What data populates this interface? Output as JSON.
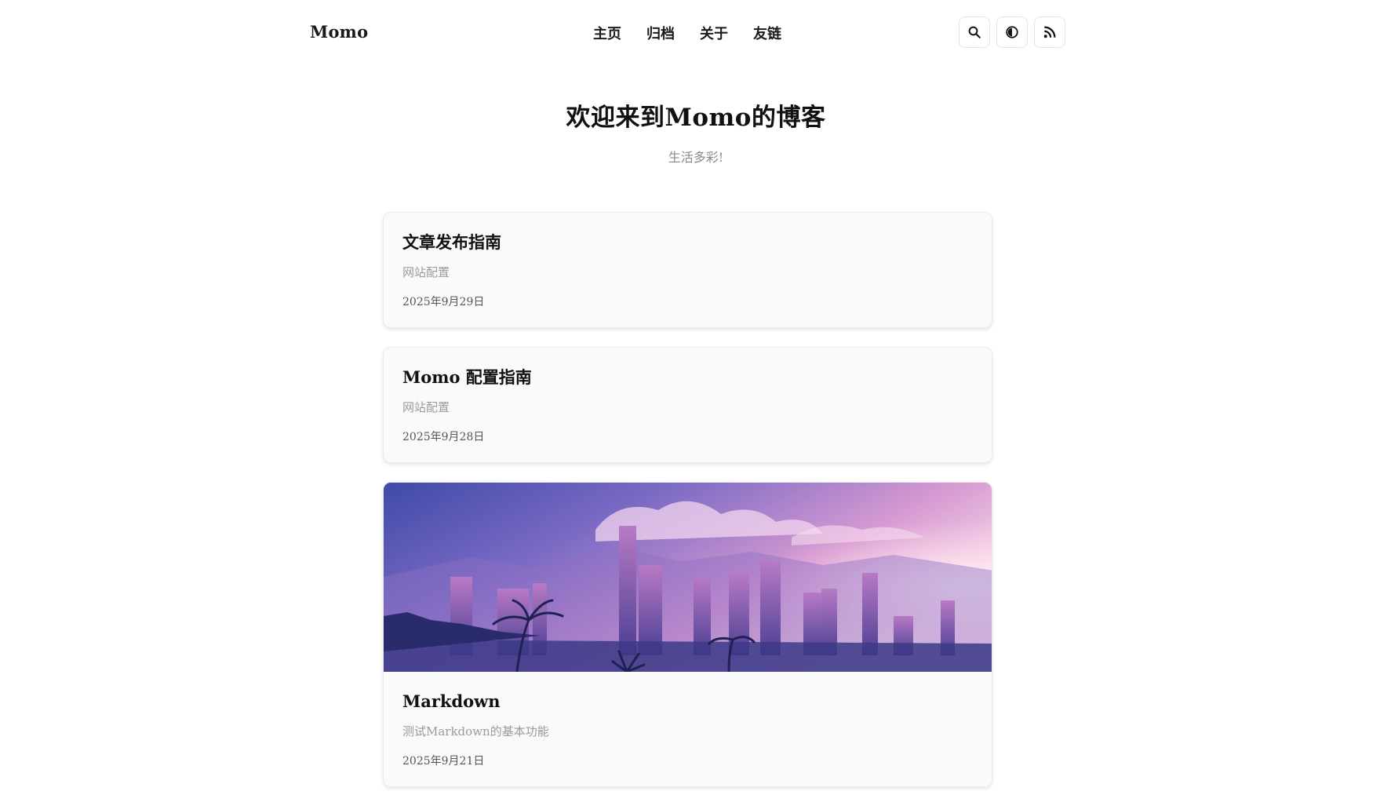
{
  "header": {
    "brand": "Momo",
    "nav": [
      {
        "label": "主页"
      },
      {
        "label": "归档"
      },
      {
        "label": "关于"
      },
      {
        "label": "友链"
      }
    ],
    "tools": {
      "search_icon": "search-icon",
      "theme_icon": "theme-toggle-icon",
      "rss_icon": "rss-icon"
    }
  },
  "hero": {
    "title": "欢迎来到Momo的博客",
    "subtitle": "生活多彩!"
  },
  "posts": [
    {
      "title": "文章发布指南",
      "category": "网站配置",
      "date": "2025年9月29日",
      "has_cover": false
    },
    {
      "title": "Momo 配置指南",
      "category": "网站配置",
      "date": "2025年9月28日",
      "has_cover": false
    },
    {
      "title": "Markdown",
      "category": "测试Markdown的基本功能",
      "date": "2025年9月21日",
      "has_cover": true
    }
  ],
  "colors": {
    "text": "#1a1a1a",
    "muted": "#9a9a9a",
    "card_bg": "#fafafa",
    "cover_sky_top": "#4a55b8",
    "cover_sky_mid": "#c98ad0",
    "cover_glow": "#ffe6f0"
  }
}
